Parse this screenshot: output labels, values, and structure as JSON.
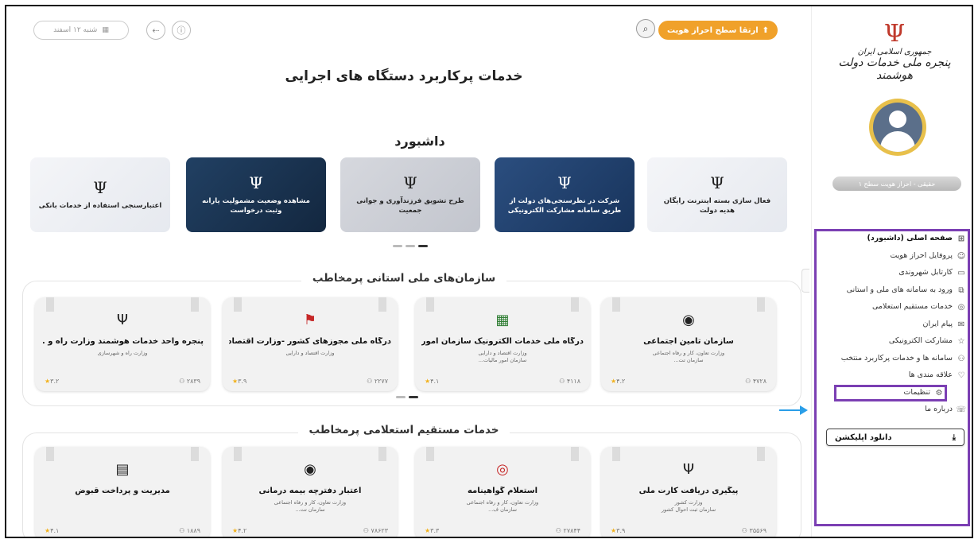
{
  "topbar": {
    "date": "شنبه ۱۲ اسفند",
    "upgrade_label": "ارتقا سطح احراز هویت"
  },
  "page_title": "خدمات پرکاربرد دستگاه های اجرایی",
  "dashboard": {
    "title": "داشبورد",
    "banners": [
      {
        "text": "فعال سازی بسته اینترنت رایگان هدیه دولت",
        "style": "light"
      },
      {
        "text": "شرکت در نظرسنجی‌های دولت از طریق سامانه مشارکت الکترونیکی",
        "style": "blue"
      },
      {
        "text": "طرح تشویق فرزندآوری و جوانی جمعیت",
        "style": "grey"
      },
      {
        "text": "مشاهده وضعیت مشمولیت یارانه وثبت درخواست",
        "style": "dark"
      },
      {
        "text": "اعتبارسنجی استفاده از خدمات بانکی",
        "style": "light"
      }
    ]
  },
  "orgs": {
    "title": "سازمان‌های ملی استانی پرمخاطب",
    "cards": [
      {
        "name": "سازمان تامین اجتماعی",
        "sub": "وزارت تعاون، کار و رفاه اجتماعی\nسازمان تت...",
        "users": "۴۷۲۸",
        "rating": "۴.۲",
        "logo": "◉"
      },
      {
        "name": "درگاه ملی خدمات الکترونیک سازمان امور...",
        "sub": "وزارت اقتصاد و دارایی\nسازمان امور مالیات...",
        "users": "۴۱۱۸",
        "rating": "۴.۱",
        "logo": "▦"
      },
      {
        "name": "درگاه ملی مجوزهای کشور -وزارت اقتصاد...",
        "sub": "وزارت اقتصاد و دارایی",
        "users": "۲۲۷۷",
        "rating": "۳.۹",
        "logo": "⚑"
      },
      {
        "name": "پنجره واحد خدمات هوشمند وزارت راه و ...",
        "sub": "وزارت راه و شهرسازی",
        "users": "۲۸۳۹",
        "rating": "۳.۲",
        "logo": "Ψ"
      }
    ]
  },
  "inquiry": {
    "title": "خدمات مستقیم استعلامی پرمخاطب",
    "cards": [
      {
        "name": "پیگیری دریافت کارت ملی",
        "sub": "وزارت کشور\nسازمان ثبت احوال کشور",
        "users": "۳۵۵۶۹",
        "rating": "۳.۹",
        "logo": "Ψ"
      },
      {
        "name": "استعلام گواهینامه",
        "sub": "وزارت تعاون، کار و رفاه اجتماعی\nسازمان ف...",
        "users": "۲۷۸۴۴",
        "rating": "۳.۳",
        "logo": "◎"
      },
      {
        "name": "اعتبار دفترچه بیمه درمانی",
        "sub": "وزارت تعاون، کار و رفاه اجتماعی\nسازمان تت...",
        "users": "۷۸۶۲۳",
        "rating": "۴.۲",
        "logo": "◉"
      },
      {
        "name": "مدیریت و پرداخت قبوض",
        "sub": "",
        "users": "۱۸۸۹",
        "rating": "۴.۱",
        "logo": "▤"
      }
    ]
  },
  "sidebar": {
    "logo_line1": "جمهوری اسلامی ایران",
    "logo_line2": "پنجره ملی خدمات دولت هوشمند",
    "status": "حقیقی - احراز هویت سطح ۱",
    "menu": [
      {
        "label": "صفحه اصلی (داشبورد)",
        "icon": "⊞",
        "bold": true
      },
      {
        "label": "پروفایل احراز هویت",
        "icon": "☺"
      },
      {
        "label": "کارتابل شهروندی",
        "icon": "▭"
      },
      {
        "label": "ورود به سامانه های ملی و استانی",
        "icon": "⧉"
      },
      {
        "label": "خدمات مستقیم استعلامی",
        "icon": "◎"
      },
      {
        "label": "پیام ایران",
        "icon": "✉"
      },
      {
        "label": "مشارکت الکترونیکی",
        "icon": "☆"
      },
      {
        "label": "سامانه ها و خدمات پرکاربرد منتخب",
        "icon": "⚇"
      },
      {
        "label": "علاقه مندی ها",
        "icon": "♡"
      },
      {
        "label": "تنظیمات",
        "icon": "⚙",
        "highlight": true
      },
      {
        "label": "درباره ما",
        "icon": "☏"
      }
    ],
    "download_label": "دانلود اپلیکشن"
  },
  "colors": {
    "accent": "#f0a12a",
    "highlight": "#7b3fb3",
    "arrow": "#2a9ee8"
  }
}
